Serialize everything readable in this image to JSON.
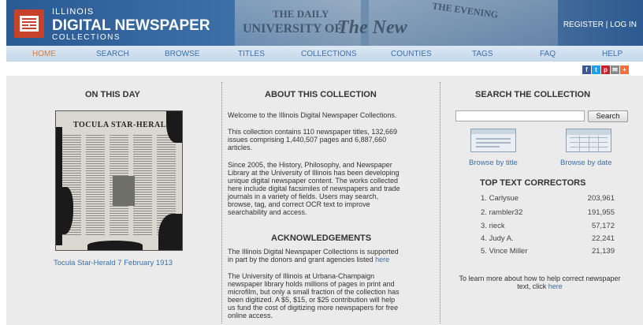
{
  "header": {
    "brand_small": "ILLINOIS",
    "brand_big": "DIGITAL NEWSPAPER",
    "brand_coll": "COLLECTIONS",
    "auth": "REGISTER | LOG IN",
    "bg_text_1": "THE DAILY",
    "bg_text_2": "UNIVERSITY OF",
    "bg_text_3": "The New",
    "bg_text_4": "THE EVENING"
  },
  "nav": {
    "items": [
      "HOME",
      "SEARCH",
      "BROWSE",
      "TITLES",
      "COLLECTIONS",
      "COUNTIES",
      "TAGS",
      "FAQ",
      "HELP"
    ],
    "active_color": "#e07a30",
    "link_color": "#3b6fa6"
  },
  "social": [
    "f",
    "t",
    "p",
    "✉",
    "+"
  ],
  "on_this_day": {
    "title": "ON THIS DAY",
    "masthead": "TOCULA STAR-HERALD",
    "caption": "Tocula Star-Herald 7 February 1913"
  },
  "about": {
    "title": "ABOUT THIS COLLECTION",
    "p1": "Welcome to the Illinois Digital Newspaper Collections.",
    "p2_lines": [
      "This collection contains 110 newspaper titles, 132,669",
      "issues comprising 1,440,507 pages and 6,887,660",
      "articles."
    ],
    "p3_lines": [
      "Since 2005, the History, Philosophy, and Newspaper",
      "Library at the University of Illinois has been developing",
      "unique digital newspaper content. The works collected",
      "here include digital facsimiles of newspapers and trade",
      "journals in a variety of fields. Users may search,",
      "browse, tag, and correct OCR text to improve",
      "searchability and access."
    ]
  },
  "acknowledgements": {
    "title": "ACKNOWLEDGEMENTS",
    "p1_lines": [
      "The Illinois Digital Newspaper Collections is supported",
      "in part by the donors and grant agencies listed"
    ],
    "p1_link": "here",
    "p2_lines": [
      "The University of Illinois at Urbana-Champaign",
      "newspaper library holds millions of pages in print and",
      "microfilm, but only a small fraction of the collection has",
      "been digitized. A $5, $15, or $25 contribution will help",
      "us fund the cost of digitizing more newspapers for free",
      "online access."
    ]
  },
  "search": {
    "title": "SEARCH THE COLLECTION",
    "input_value": "",
    "button": "Search",
    "browse_title": "Browse by title",
    "browse_date": "Browse by date"
  },
  "correctors": {
    "title": "TOP TEXT CORRECTORS",
    "rows": [
      {
        "rank": "1.",
        "name": "Carlysue",
        "score": "203,961"
      },
      {
        "rank": "2.",
        "name": "rambler32",
        "score": "191,955"
      },
      {
        "rank": "3.",
        "name": "rieck",
        "score": "57,172"
      },
      {
        "rank": "4.",
        "name": "Judy A.",
        "score": "22,241"
      },
      {
        "rank": "5.",
        "name": "Vince Miller",
        "score": "21,139"
      }
    ],
    "help_line1": "To learn more about how to help correct newspaper",
    "help_line2": "text, click",
    "help_link": "here"
  }
}
